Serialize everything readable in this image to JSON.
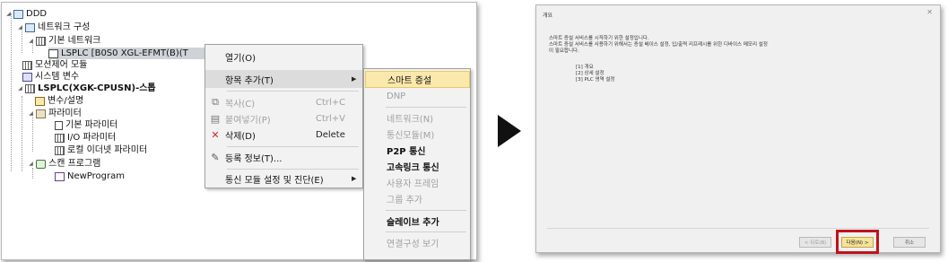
{
  "tree": {
    "root": "DDD",
    "network_config": "네트워크 구성",
    "basic_network": "기본 네트워크",
    "lsplc_node": "LSPLC [B0S0 XGL-EFMT(B)(T",
    "motion_module": "모션제어 모듈",
    "system_vars": "시스템 변수",
    "lsplc_cpu": "LSPLC(XGK-CPUSN)-스톱",
    "vars_comments": "변수/설명",
    "parameters": "파라미터",
    "basic_params": "기본 파라미터",
    "io_params": "I/O 파라미터",
    "local_ethernet_params": "로컬 이더넷 파라미터",
    "scan_program": "스캔 프로그램",
    "new_program": "NewProgram"
  },
  "context_menu": {
    "open": "열기(O)",
    "add_item": "항목 추가(T)",
    "copy": "복사(C)",
    "copy_shortcut": "Ctrl+C",
    "paste": "붙여넣기(P)",
    "paste_shortcut": "Ctrl+V",
    "delete": "삭제(D)",
    "delete_shortcut": "Delete",
    "properties": "등록 정보(T)...",
    "comm_settings": "통신 모듈 설정 및 진단(E)"
  },
  "submenu": {
    "smart_expansion": "스마트 증설",
    "dnp": "DNP",
    "network": "네트워크(N)",
    "comm_module": "통신모듈(M)",
    "p2p": "P2P 통신",
    "high_speed_link": "고속링크 통신",
    "user_frame": "사용자 프레임",
    "add_group": "그룹 추가",
    "add_slave": "슬레이브 추가",
    "link_view": "연결구성 보기"
  },
  "dialog": {
    "title": "개요",
    "line1": "스마트 증설 서비스를 시작하기 위한 설정입니다.",
    "line2": "스마트 증설 서비스를 사용하기 위해서는 증설 베이스 설정, 입/출력 리프레시를 위한 디바이스 메모리 설정",
    "line3": "이 필요합니다.",
    "item1": "[1] 개요",
    "item2": "[2] 상세 설정",
    "item3": "[3] PLC 영역 설정",
    "back_button": "< 뒤로(B)",
    "next_button": "다음(N) >",
    "cancel_button": "취소"
  },
  "colors": {
    "highlight_border": "#c1121b",
    "submenu_hover": "#fbe8ac",
    "next_button": "#f6e39a"
  }
}
